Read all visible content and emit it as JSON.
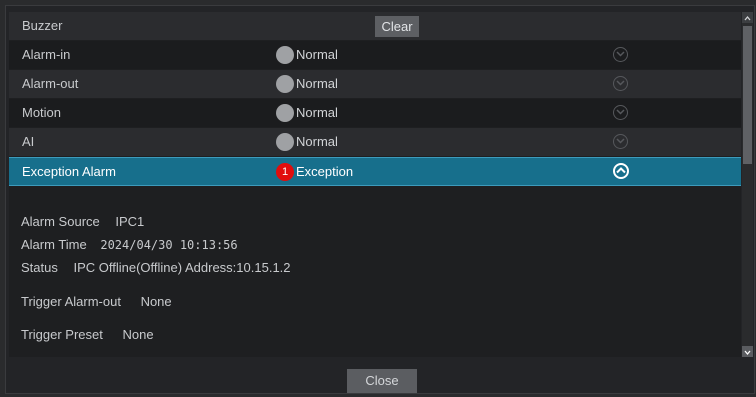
{
  "header": {
    "title": "Buzzer",
    "clear_label": "Clear"
  },
  "rows": [
    {
      "label": "Alarm-in",
      "status": "Normal"
    },
    {
      "label": "Alarm-out",
      "status": "Normal"
    },
    {
      "label": "Motion",
      "status": "Normal"
    },
    {
      "label": "AI",
      "status": "Normal"
    },
    {
      "label": "Exception Alarm",
      "status": "Exception",
      "badge": "1"
    }
  ],
  "details": {
    "alarm_source_label": "Alarm Source",
    "alarm_source_value": "IPC1",
    "alarm_time_label": "Alarm Time",
    "alarm_time_value": "2024/04/30 10:13:56",
    "status_label": "Status",
    "status_value": "IPC Offline(Offline) Address:10.15.1.2",
    "trigger_alarm_out_label": "Trigger Alarm-out",
    "trigger_alarm_out_value": "None",
    "trigger_preset_label": "Trigger Preset",
    "trigger_preset_value": "None"
  },
  "footer": {
    "close_label": "Close"
  },
  "colors": {
    "selected_row": "#176f8c",
    "exception_badge": "#e10d0d",
    "normal_dot": "#9fa1a4"
  },
  "icons": {
    "expand": "chevron-down-icon",
    "collapse": "chevron-up-icon"
  }
}
